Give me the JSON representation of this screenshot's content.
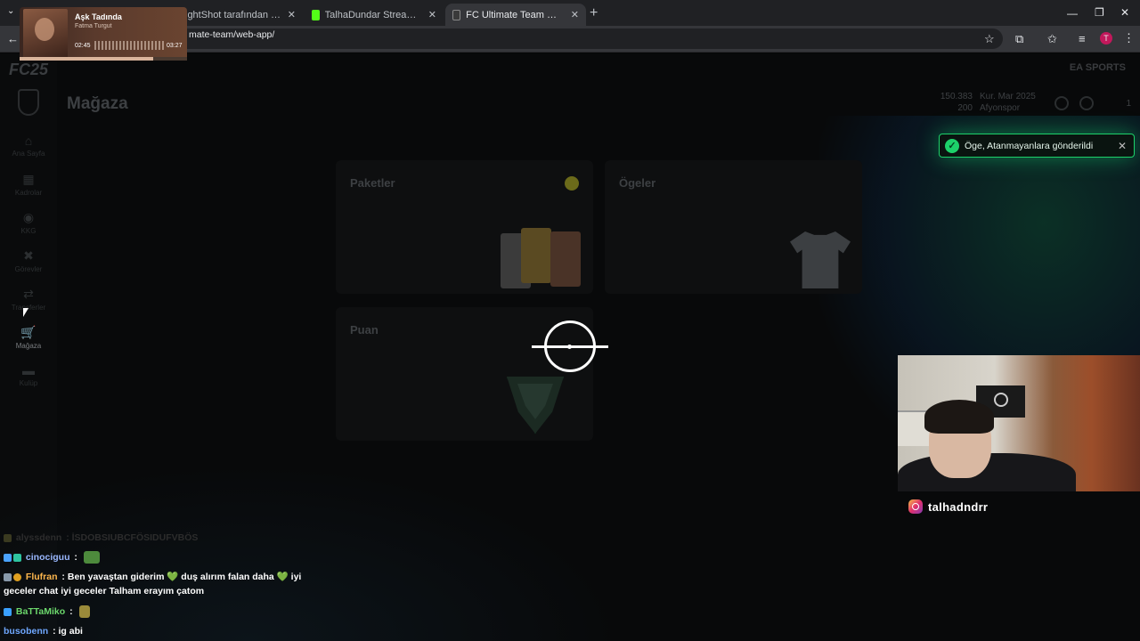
{
  "browser": {
    "tabs": [
      {
        "label": "ightShot tarafından Ekran Gör"
      },
      {
        "label": "TalhaDundar Stream - Watch Li"
      },
      {
        "label": "FC Ultimate Team Web App - Eli"
      }
    ],
    "url": "mate-team/web-app/",
    "profile_initial": "T"
  },
  "media": {
    "title": "Aşk Tadında",
    "artist": "Fatma Turgut",
    "elapsed": "02:45",
    "duration": "03:27",
    "progress": 0.8
  },
  "app": {
    "logo": "FC25",
    "brand": "EA SPORTS",
    "page_title": "Mağaza",
    "currency": {
      "coins": "150.383",
      "points": "200"
    },
    "season": "Kur. Mar 2025",
    "club": "Afyonspor",
    "unassigned_count": "1",
    "sidebar": [
      {
        "label": "Ana Sayfa",
        "icon": "home-icon"
      },
      {
        "label": "Kadrolar",
        "icon": "squad-icon"
      },
      {
        "label": "KKG",
        "icon": "sbc-icon"
      },
      {
        "label": "Görevler",
        "icon": "objectives-icon"
      },
      {
        "label": "Transferler",
        "icon": "transfer-icon"
      },
      {
        "label": "Mağaza",
        "icon": "cart-icon"
      },
      {
        "label": "Kulüp",
        "icon": "club-icon"
      }
    ],
    "cards": {
      "packs": "Paketler",
      "items": "Ögeler",
      "points": "Puan"
    },
    "toast": "Öge, Atanmayanlara gönderildi"
  },
  "stream": {
    "instagram": "talhadndrr"
  },
  "chat": [
    {
      "user": "alyssdenn",
      "text": "İSDOBSIUBCFÖSIDUFVBÖS",
      "color": "#3a3a3a"
    },
    {
      "user": "cinociguu",
      "text": "",
      "color": "#9ab8ff"
    },
    {
      "user": "Flufran",
      "text": "Ben yavaştan giderim 💚 duş alırım falan daha 💚 iyi",
      "text2": "geceler chat iyi geceler Talham erayım çatom",
      "color": "#ffb74d"
    },
    {
      "user": "BaTTaMiko",
      "text": "",
      "color": "#6cd86c"
    },
    {
      "user": "busobenn",
      "text": "ig abi",
      "color": "#6fa7ff"
    }
  ]
}
